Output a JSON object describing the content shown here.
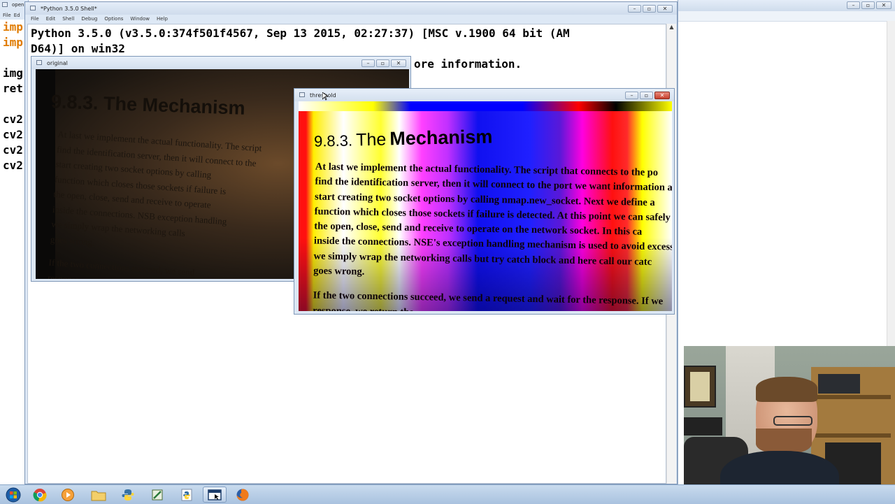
{
  "bg_window": {
    "title": "open",
    "menu": [
      "File",
      "Ed"
    ],
    "code_lines": [
      "imp",
      "imp",
      "",
      "img",
      "ret",
      "",
      "cv2",
      "cv2",
      "cv2",
      "cv2"
    ]
  },
  "shell": {
    "title": "*Python 3.5.0 Shell*",
    "menu": [
      "File",
      "Edit",
      "Shell",
      "Debug",
      "Options",
      "Window",
      "Help"
    ],
    "line1": "Python 3.5.0 (v3.5.0:374f501f4567, Sep 13 2015, 02:27:37) [MSC v.1900 64 bit (AM",
    "line2": "D64)] on win32",
    "line3_tail": "ore information."
  },
  "original_window": {
    "title": "original",
    "doc": {
      "heading": "9.8.3. The Mechanism",
      "lines": [
        "At last we implement the actual functionality. The script",
        "find the identification server, then it will connect to the",
        "start creating two socket options by calling",
        "function which closes those sockets if failure is",
        "the open, close, send and receive to operate",
        "inside the connections. NSB exception handling",
        "we simply wrap the networking calls",
        "goes wrong.",
        "",
        "If the two connections succeed, we send",
        "response, we return the"
      ]
    }
  },
  "threshold_window": {
    "title": "threshold",
    "doc": {
      "heading_num": "9.8.3.",
      "heading_a": "The",
      "heading_b": "Mechanism",
      "lines": [
        "At last we implement the actual functionality. The script that connects to the po",
        "find the identification server, then it will connect to the port we want information a",
        "start creating two socket options by calling nmap.new_socket. Next we define a",
        "function which closes those sockets if failure is detected. At this point we can safely",
        "the open, close, send and receive to operate on the network socket. In this ca",
        "inside the connections. NSE's exception handling mechanism is used to avoid excess",
        "we simply wrap the networking calls but try catch block and here call our catc",
        "goes wrong.",
        "",
        "If the two connections succeed, we send a request and wait for the response. If we",
        "response, we return the"
      ]
    }
  },
  "right_window": {
    "title": ""
  },
  "taskbar": {
    "items": [
      {
        "name": "start-button",
        "icon": "windows-orb-icon"
      },
      {
        "name": "chrome-taskbar-button",
        "icon": "chrome-icon"
      },
      {
        "name": "media-player-taskbar-button",
        "icon": "media-player-icon"
      },
      {
        "name": "explorer-taskbar-button",
        "icon": "folder-icon"
      },
      {
        "name": "python-taskbar-button",
        "icon": "python-icon"
      },
      {
        "name": "editor-taskbar-button",
        "icon": "editor-icon"
      },
      {
        "name": "python-idle-taskbar-button",
        "icon": "python-icon"
      },
      {
        "name": "opencv-taskbar-button",
        "icon": "window-app-icon"
      },
      {
        "name": "firefox-taskbar-button",
        "icon": "firefox-icon"
      }
    ]
  },
  "colors": {
    "keyword_orange": "#e07b00",
    "titlebar_blue": "#dae6f4",
    "taskbar": "#b5cbe4"
  }
}
